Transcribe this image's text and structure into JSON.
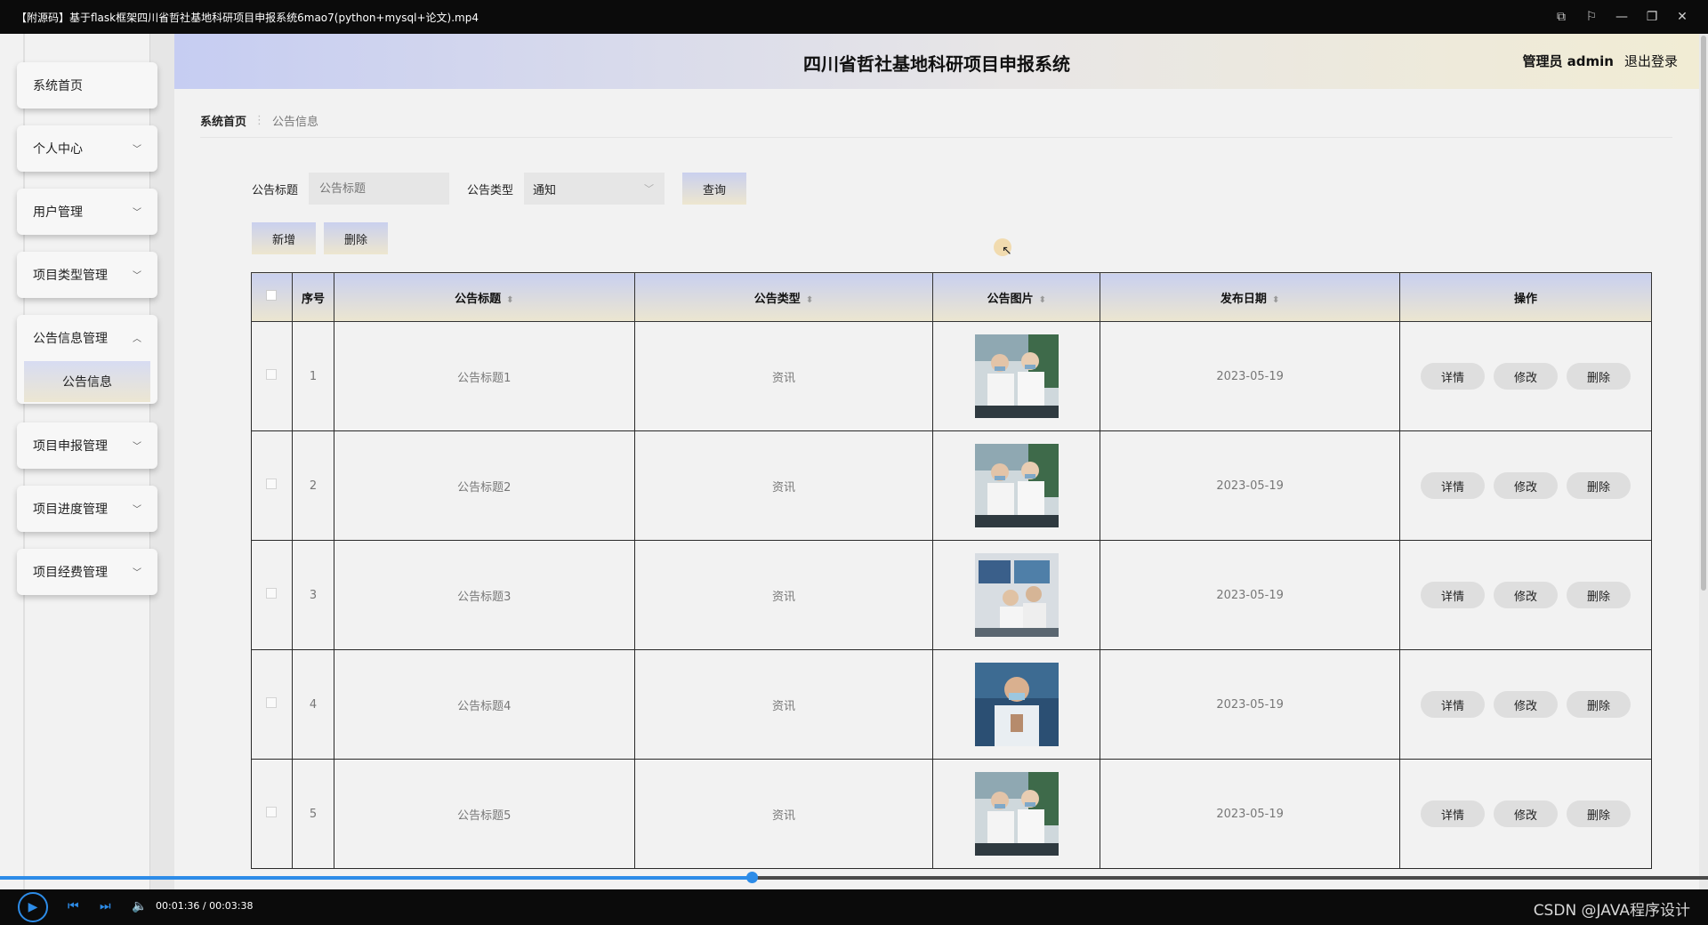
{
  "player": {
    "window_title": "【附源码】基于flask框架四川省哲社基地科研项目申报系统6mao7(python+mysql+论文).mp4",
    "timecode": "00:01:36 / 00:03:38",
    "progress_fraction": 0.44,
    "watermark": "CSDN @JAVA程序设计"
  },
  "header": {
    "title": "四川省哲社基地科研项目申报系统",
    "user_label": "管理员 admin",
    "logout_label": "退出登录"
  },
  "sidebar": {
    "items": [
      {
        "label": "系统首页",
        "has_chevron": false
      },
      {
        "label": "个人中心",
        "has_chevron": true
      },
      {
        "label": "用户管理",
        "has_chevron": true
      },
      {
        "label": "项目类型管理",
        "has_chevron": true
      },
      {
        "label": "公告信息管理",
        "has_chevron": true,
        "expanded": true,
        "sub": "公告信息"
      },
      {
        "label": "项目申报管理",
        "has_chevron": true
      },
      {
        "label": "项目进度管理",
        "has_chevron": true
      },
      {
        "label": "项目经费管理",
        "has_chevron": true
      }
    ]
  },
  "breadcrumb": {
    "home": "系统首页",
    "current": "公告信息"
  },
  "search": {
    "title_label": "公告标题",
    "title_placeholder": "公告标题",
    "type_label": "公告类型",
    "type_value": "通知",
    "query_label": "查询"
  },
  "actions": {
    "add_label": "新增",
    "delete_label": "删除"
  },
  "table": {
    "columns": [
      "序号",
      "公告标题",
      "公告类型",
      "公告图片",
      "发布日期",
      "操作"
    ],
    "rows": [
      {
        "index": "1",
        "title": "公告标题1",
        "type": "资讯",
        "date": "2023-05-19",
        "image": "lab-two-scientists"
      },
      {
        "index": "2",
        "title": "公告标题2",
        "type": "资讯",
        "date": "2023-05-19",
        "image": "lab-two-scientists"
      },
      {
        "index": "3",
        "title": "公告标题3",
        "type": "资讯",
        "date": "2023-05-19",
        "image": "lab-monitors"
      },
      {
        "index": "4",
        "title": "公告标题4",
        "type": "资讯",
        "date": "2023-05-19",
        "image": "lab-scientist-blue"
      },
      {
        "index": "5",
        "title": "公告标题5",
        "type": "资讯",
        "date": "2023-05-19",
        "image": "lab-two-scientists"
      }
    ],
    "row_buttons": {
      "detail": "详情",
      "edit": "修改",
      "delete": "删除"
    }
  }
}
